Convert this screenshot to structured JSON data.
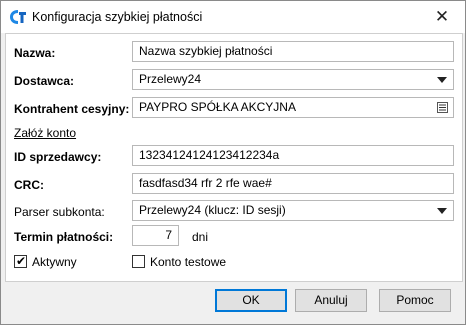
{
  "window": {
    "title": "Konfiguracja szybkiej płatności",
    "icon": "app-logo-icon",
    "close_glyph": "✕"
  },
  "form": {
    "name": {
      "label": "Nazwa:",
      "value": "Nazwa szybkiej płatności"
    },
    "provider": {
      "label": "Dostawca:",
      "value": "Przelewy24"
    },
    "cessionary": {
      "label": "Kontrahent cesyjny:",
      "value": "PAYPRO SPÓŁKA AKCYJNA"
    },
    "create_account_link": "Załóż konto",
    "merchant_id": {
      "label": "ID sprzedawcy:",
      "value": "13234124124123412234a"
    },
    "crc": {
      "label": "CRC:",
      "value": "fasdfasd34 rfr 2 rfe wae#"
    },
    "subaccount_parser": {
      "label": "Parser subkonta:",
      "value": "Przelewy24 (klucz: ID sesji)"
    },
    "payment_term": {
      "label": "Termin płatności:",
      "value": "7",
      "unit": "dni"
    },
    "active": {
      "label": "Aktywny",
      "checked": true
    },
    "test_account": {
      "label": "Konto testowe",
      "checked": false
    }
  },
  "buttons": {
    "ok": "OK",
    "cancel": "Anuluj",
    "help": "Pomoc"
  }
}
